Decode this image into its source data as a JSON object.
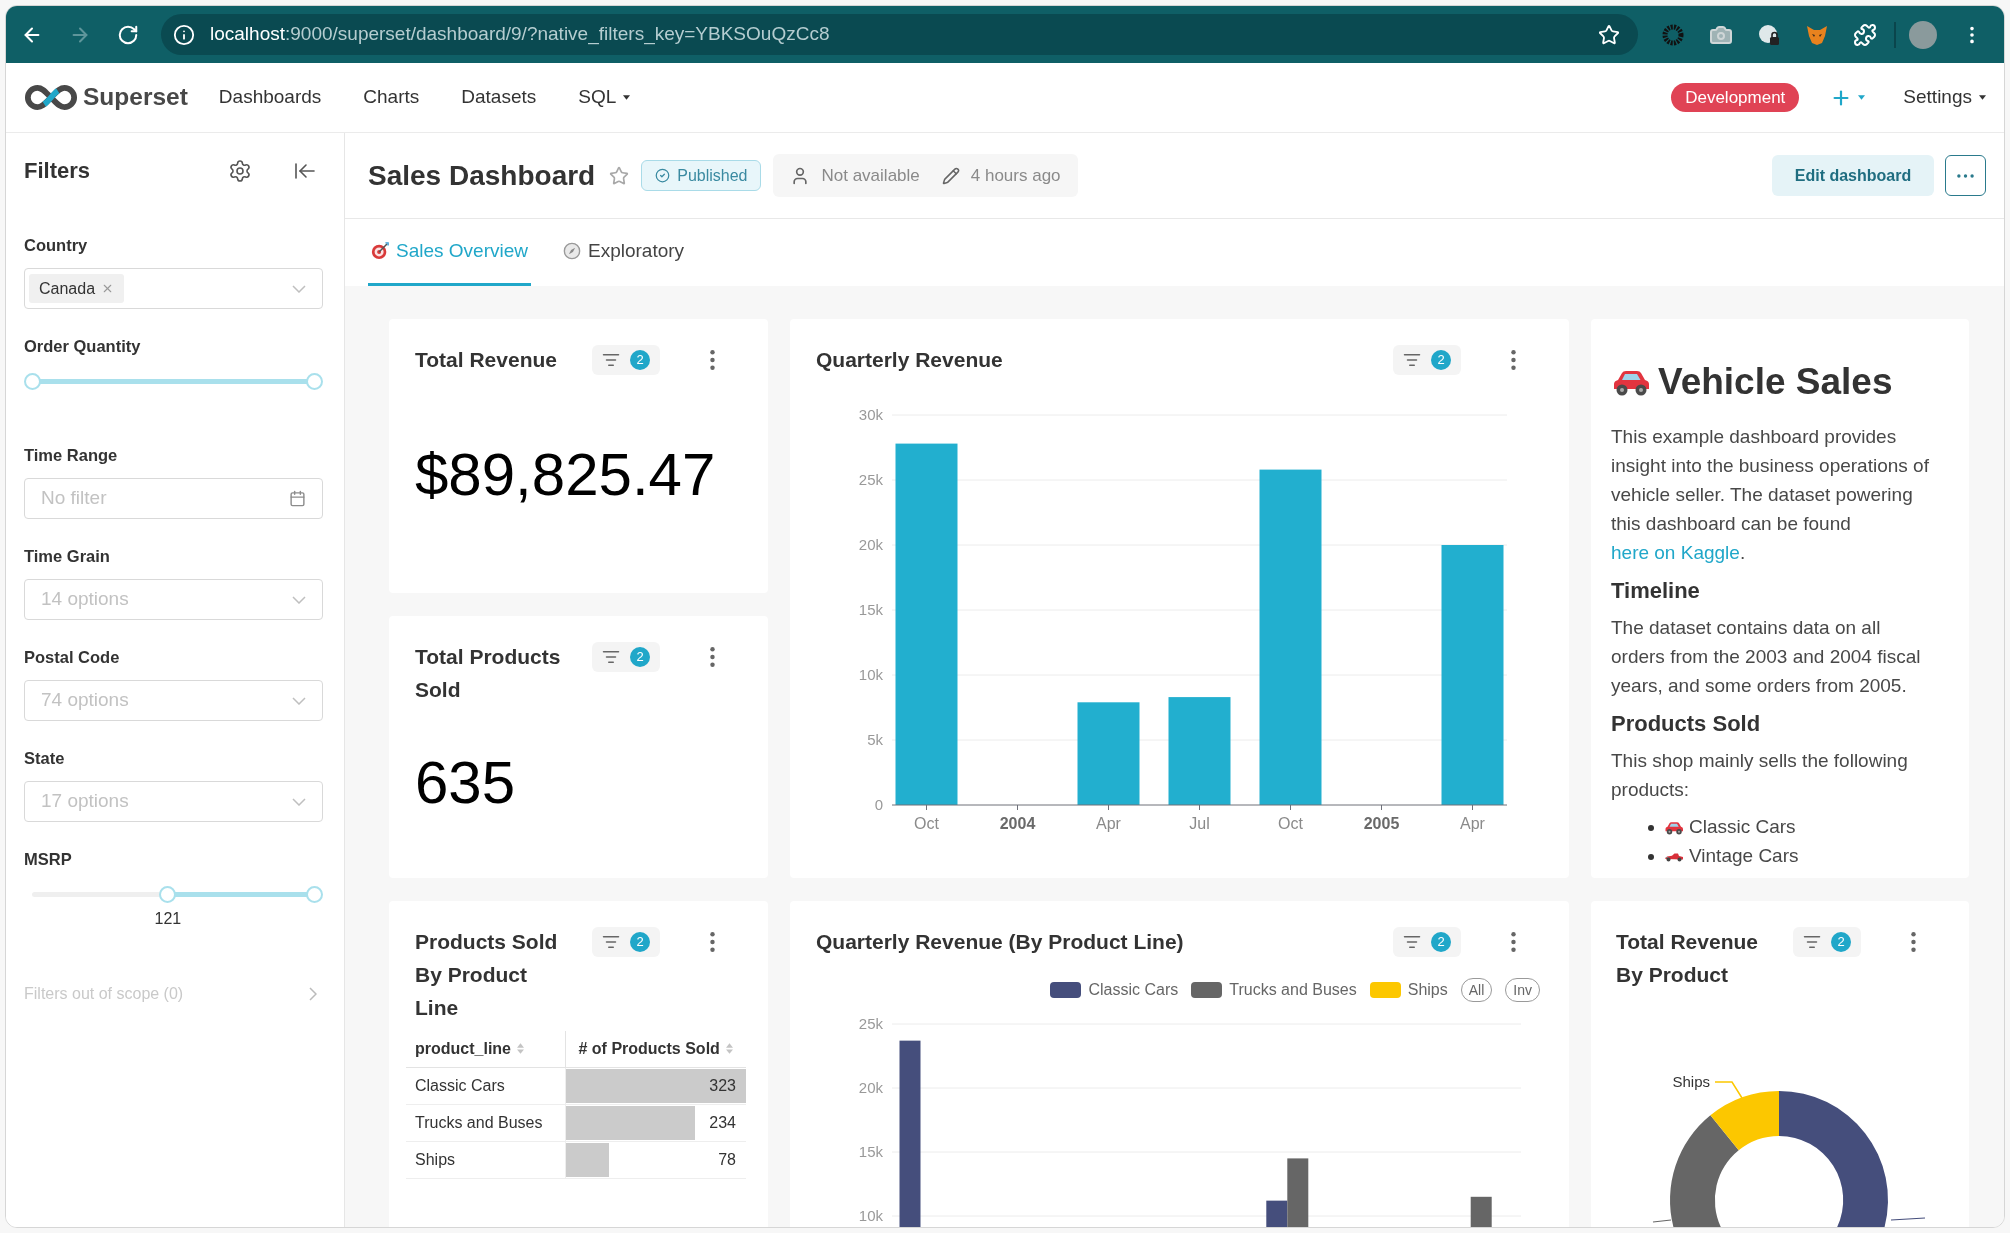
{
  "browser": {
    "nav_buttons": [
      {
        "kind": "back",
        "disabled": false
      },
      {
        "kind": "forward",
        "disabled": true
      },
      {
        "kind": "reload",
        "disabled": false
      }
    ],
    "url": {
      "host": "localhost",
      "path": ":9000/superset/dashboard/9/?native_filters_key=YBKSOuQzCc8"
    },
    "bookmarked": false
  },
  "navbar": {
    "brand": "Superset",
    "menu": [
      {
        "label": "Dashboards",
        "dropdown": false
      },
      {
        "label": "Charts",
        "dropdown": false
      },
      {
        "label": "Datasets",
        "dropdown": false
      },
      {
        "label": "SQL",
        "dropdown": true
      }
    ],
    "environment": "Development",
    "add_menu": {
      "dropdown": true
    },
    "settings": {
      "label": "Settings",
      "dropdown": true
    }
  },
  "filters_panel": {
    "title": "Filters",
    "filters": [
      {
        "kind": "select",
        "label": "Country",
        "tags": [
          "Canada"
        ]
      },
      {
        "kind": "range",
        "label": "Order Quantity",
        "thumbs": [
          {
            "level": 0
          },
          {
            "level": 1
          }
        ]
      },
      {
        "kind": "date",
        "label": "Time Range",
        "placeholder": "No filter"
      },
      {
        "kind": "select",
        "label": "Time Grain",
        "placeholder": "14 options"
      },
      {
        "kind": "select",
        "label": "Postal Code",
        "placeholder": "74 options"
      },
      {
        "kind": "select",
        "label": "State",
        "placeholder": "17 options"
      },
      {
        "kind": "range",
        "label": "MSRP",
        "thumbs": [
          {
            "level": 0.48,
            "reading": "121"
          },
          {
            "level": 1
          }
        ]
      }
    ],
    "out_of_scope": "Filters out of scope (0)"
  },
  "header": {
    "title": "Sales Dashboard",
    "favorite": false,
    "status": "Published",
    "owner": "Not available",
    "modified": "4 hours ago",
    "edit_button": "Edit dashboard"
  },
  "tabs": [
    {
      "label": "Sales Overview",
      "selected": true
    },
    {
      "label": "Exploratory",
      "selected": false
    }
  ],
  "total_revenue": {
    "title": "Total Revenue",
    "filter_count": "2",
    "value": "$89,825.47"
  },
  "total_products_sold": {
    "title": "Total Products Sold",
    "filter_count": "2",
    "value": "635"
  },
  "quarterly_revenue": {
    "title": "Quarterly Revenue",
    "filter_count": "2",
    "category_bold": [
      false,
      true,
      false,
      false,
      false,
      true,
      false
    ],
    "chart_data": {
      "type": "bar",
      "categories": [
        "Oct",
        "2004",
        "Apr",
        "Jul",
        "Oct",
        "2005",
        "Apr"
      ],
      "values": [
        27800,
        null,
        7900,
        8300,
        25800,
        null,
        20000
      ],
      "ylim": [
        0,
        30000
      ],
      "yticks": [
        {
          "value": 0,
          "label": "0"
        },
        {
          "value": 5000,
          "label": "5k"
        },
        {
          "value": 10000,
          "label": "10k"
        },
        {
          "value": 15000,
          "label": "15k"
        },
        {
          "value": 20000,
          "label": "20k"
        },
        {
          "value": 25000,
          "label": "25k"
        },
        {
          "value": 30000,
          "label": "30k"
        }
      ],
      "grid": true
    }
  },
  "vehicle_sales": {
    "heading": "Vehicle Sales",
    "intro": {
      "text": "This example dashboard provides insight into the business operations of vehicle seller. The dataset powering this dashboard can be found ",
      "link": "here on Kaggle",
      "end": "."
    },
    "sections": [
      {
        "heading": "Timeline",
        "text": "The dataset contains data on all orders from the 2003 and 2004 fiscal years, and some orders from 2005."
      },
      {
        "heading": "Products Sold",
        "text": "This shop mainly sells the following products:",
        "items": [
          "Classic Cars",
          "Vintage Cars"
        ]
      }
    ]
  },
  "products_by_line": {
    "title": "Products Sold By Product Line",
    "filter_count": "2",
    "columns": [
      "product_line",
      "# of Products Sold"
    ],
    "rows": [
      {
        "product_line": "Classic Cars",
        "count": "323",
        "level": 1
      },
      {
        "product_line": "Trucks and Buses",
        "count": "234",
        "level": 0.72
      },
      {
        "product_line": "Ships",
        "count": "78",
        "level": 0.24
      }
    ]
  },
  "quarterly_by_line": {
    "title": "Quarterly Revenue (By Product Line)",
    "filter_count": "2",
    "legend_controls": [
      "All",
      "Inv"
    ],
    "chart_data": {
      "type": "bar",
      "series": [
        {
          "name": "Classic Cars",
          "color": "#454e7c",
          "values": [
            23700,
            null,
            null,
            null,
            11200,
            null,
            null
          ]
        },
        {
          "name": "Trucks and Buses",
          "color": "#666666",
          "values": [
            null,
            null,
            null,
            null,
            14500,
            null,
            11500
          ]
        },
        {
          "name": "Ships",
          "color": "#fcc700",
          "values": [
            null,
            null,
            null,
            null,
            null,
            null,
            null
          ]
        }
      ],
      "ylim": [
        10000,
        25000
      ],
      "yticks": [
        {
          "value": 10000,
          "label": "10k"
        },
        {
          "value": 15000,
          "label": "15k"
        },
        {
          "value": 20000,
          "label": "20k"
        },
        {
          "value": 25000,
          "label": "25k"
        }
      ],
      "grid": true
    }
  },
  "revenue_by_product": {
    "title": "Total Revenue By Product",
    "filter_count": "2",
    "slice_label": "Ships"
  }
}
